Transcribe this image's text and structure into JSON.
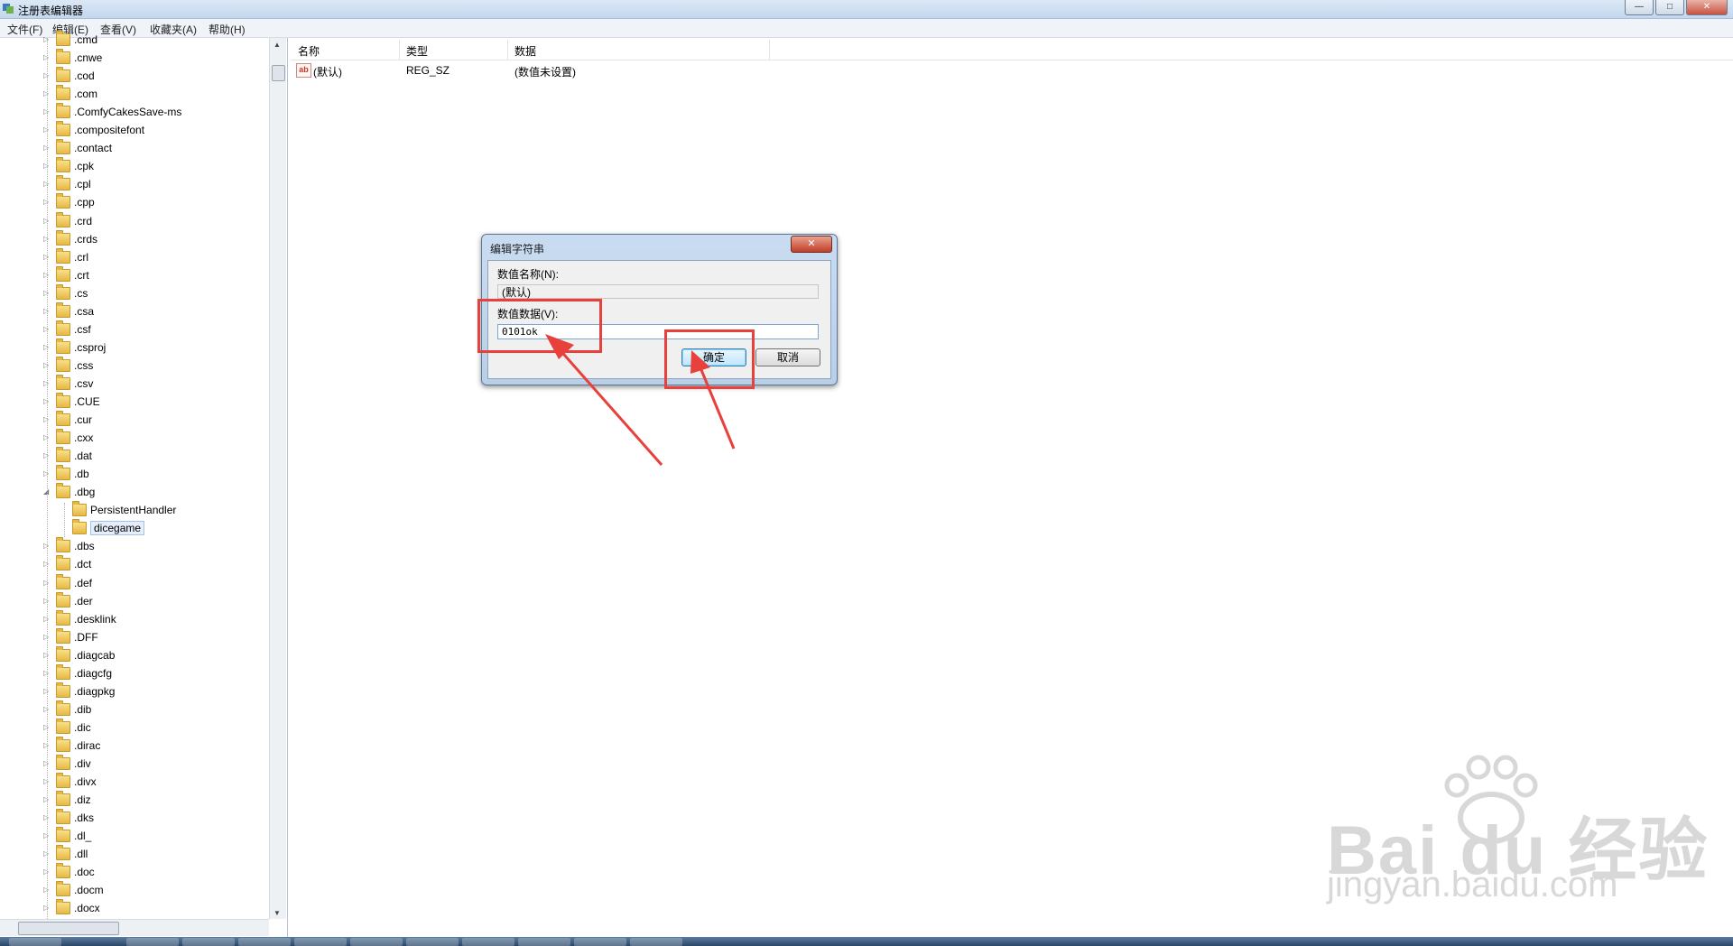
{
  "window": {
    "title": "注册表编辑器",
    "buttons": {
      "minimize": "—",
      "maximize": "□",
      "close": "✕"
    }
  },
  "menu": {
    "items": [
      "文件(F)",
      "编辑(E)",
      "查看(V)",
      "收藏夹(A)",
      "帮助(H)"
    ]
  },
  "tree": {
    "items": [
      ".cmd",
      ".cnwe",
      ".cod",
      ".com",
      ".ComfyCakesSave-ms",
      ".compositefont",
      ".contact",
      ".cpk",
      ".cpl",
      ".cpp",
      ".crd",
      ".crds",
      ".crl",
      ".crt",
      ".cs",
      ".csa",
      ".csf",
      ".csproj",
      ".css",
      ".csv",
      ".CUE",
      ".cur",
      ".cxx",
      ".dat",
      ".db",
      ".dbg",
      "PersistentHandler",
      "dicegame",
      ".dbs",
      ".dct",
      ".def",
      ".der",
      ".desklink",
      ".DFF",
      ".diagcab",
      ".diagcfg",
      ".diagpkg",
      ".dib",
      ".dic",
      ".dirac",
      ".div",
      ".divx",
      ".diz",
      ".dks",
      ".dl_",
      ".dll",
      ".doc",
      ".docm",
      ".docx"
    ],
    "selected": "dicegame"
  },
  "list": {
    "columns": [
      "名称",
      "类型",
      "数据"
    ],
    "rows": [
      {
        "name": "(默认)",
        "type": "REG_SZ",
        "data": "(数值未设置)"
      }
    ]
  },
  "dialog": {
    "title": "编辑字符串",
    "close": "✕",
    "name_label": "数值名称(N):",
    "name_value": "(默认)",
    "data_label": "数值数据(V):",
    "data_value": "0101ok",
    "ok": "确定",
    "cancel": "取消"
  },
  "watermark": {
    "main": "Bai du 经验",
    "sub": "jingyan.baidu.com"
  },
  "colors": {
    "annotation": "#e8403a",
    "selection": "#e5eefb",
    "titlebar": "#c3d7ee"
  }
}
